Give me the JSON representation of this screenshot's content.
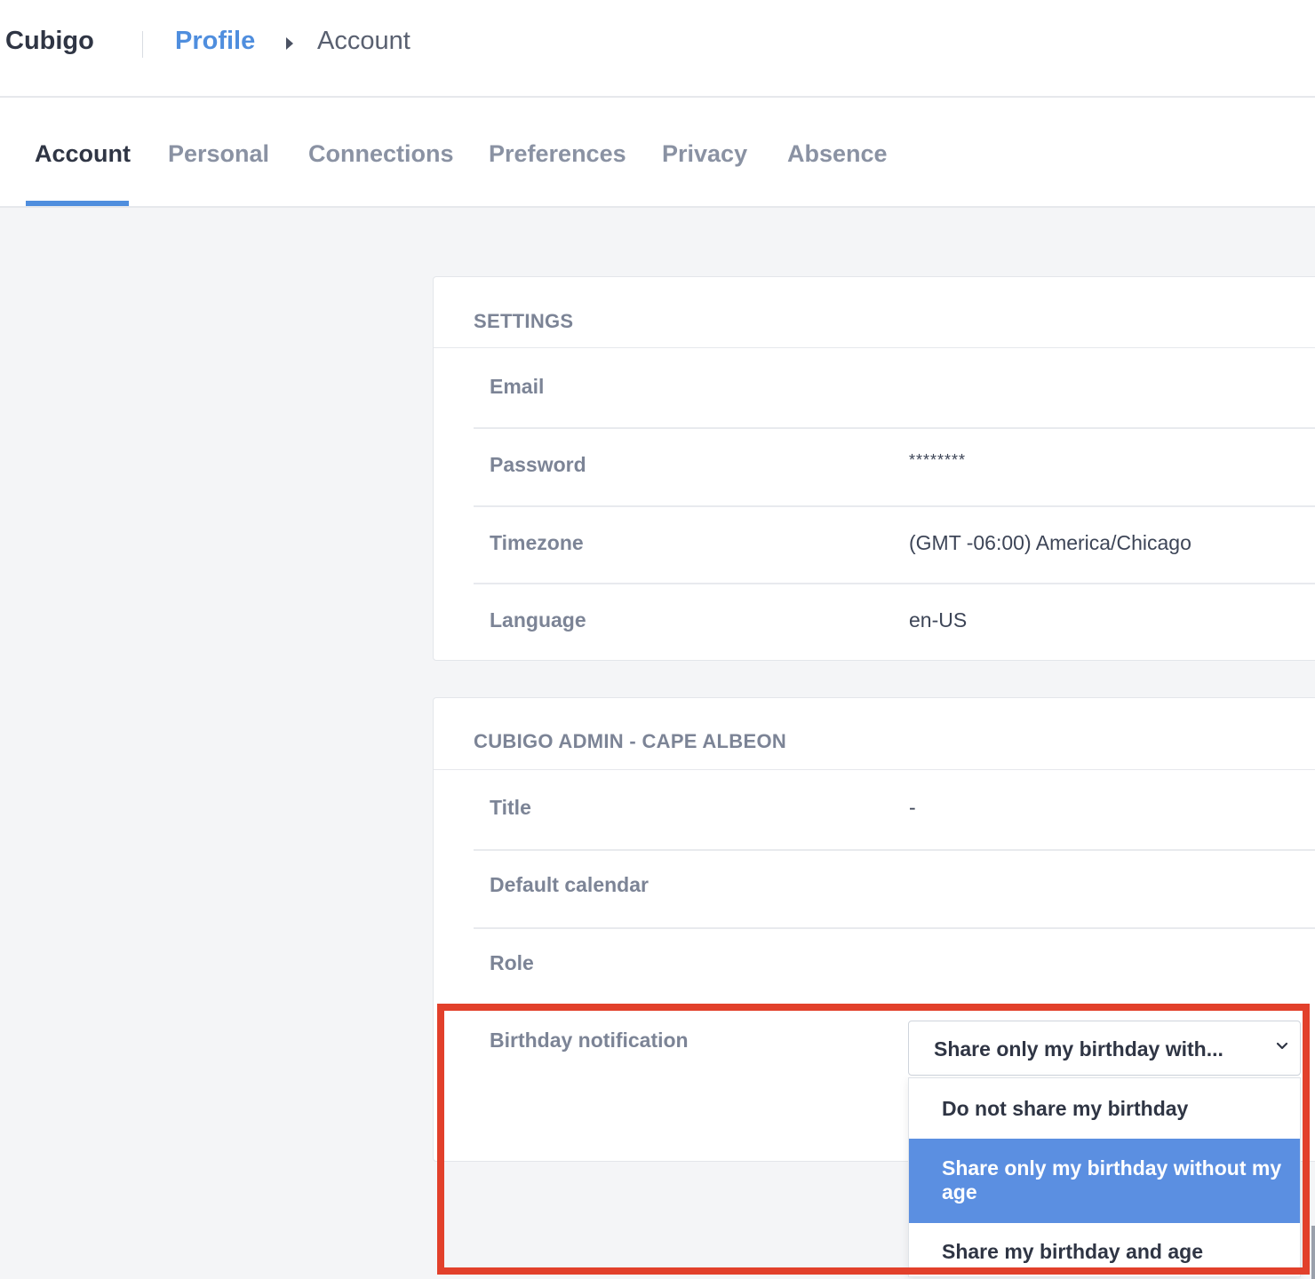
{
  "header": {
    "brand": "Cubigo",
    "breadcrumb": {
      "parent": "Profile",
      "current": "Account"
    }
  },
  "tabs": [
    {
      "label": "Account",
      "active": true
    },
    {
      "label": "Personal",
      "active": false
    },
    {
      "label": "Connections",
      "active": false
    },
    {
      "label": "Preferences",
      "active": false
    },
    {
      "label": "Privacy",
      "active": false
    },
    {
      "label": "Absence",
      "active": false
    }
  ],
  "settings_card": {
    "heading": "SETTINGS",
    "rows": [
      {
        "label": "Email",
        "value": ""
      },
      {
        "label": "Password",
        "value": "********"
      },
      {
        "label": "Timezone",
        "value": "(GMT -06:00) America/Chicago"
      },
      {
        "label": "Language",
        "value": "en-US"
      }
    ]
  },
  "org_card": {
    "heading": "CUBIGO ADMIN - CAPE ALBEON",
    "rows": [
      {
        "label": "Title",
        "value": "-"
      },
      {
        "label": "Default calendar",
        "value": ""
      },
      {
        "label": "Role",
        "value": ""
      }
    ],
    "birthday": {
      "label": "Birthday notification",
      "selected": "Share only my birthday with...",
      "options": [
        {
          "label": "Do not share my birthday",
          "highlighted": false
        },
        {
          "label": "Share only my birthday without my age",
          "highlighted": true
        },
        {
          "label": "Share my birthday and age",
          "highlighted": false
        }
      ]
    }
  },
  "colors": {
    "accent": "#4f8ede",
    "option_highlight": "#5b8fe1",
    "annotation_box": "#e2402b",
    "background": "#f4f5f7"
  },
  "icons": {
    "breadcrumb_separator": "caret-right-icon",
    "select_chevron": "chevron-down-icon"
  }
}
